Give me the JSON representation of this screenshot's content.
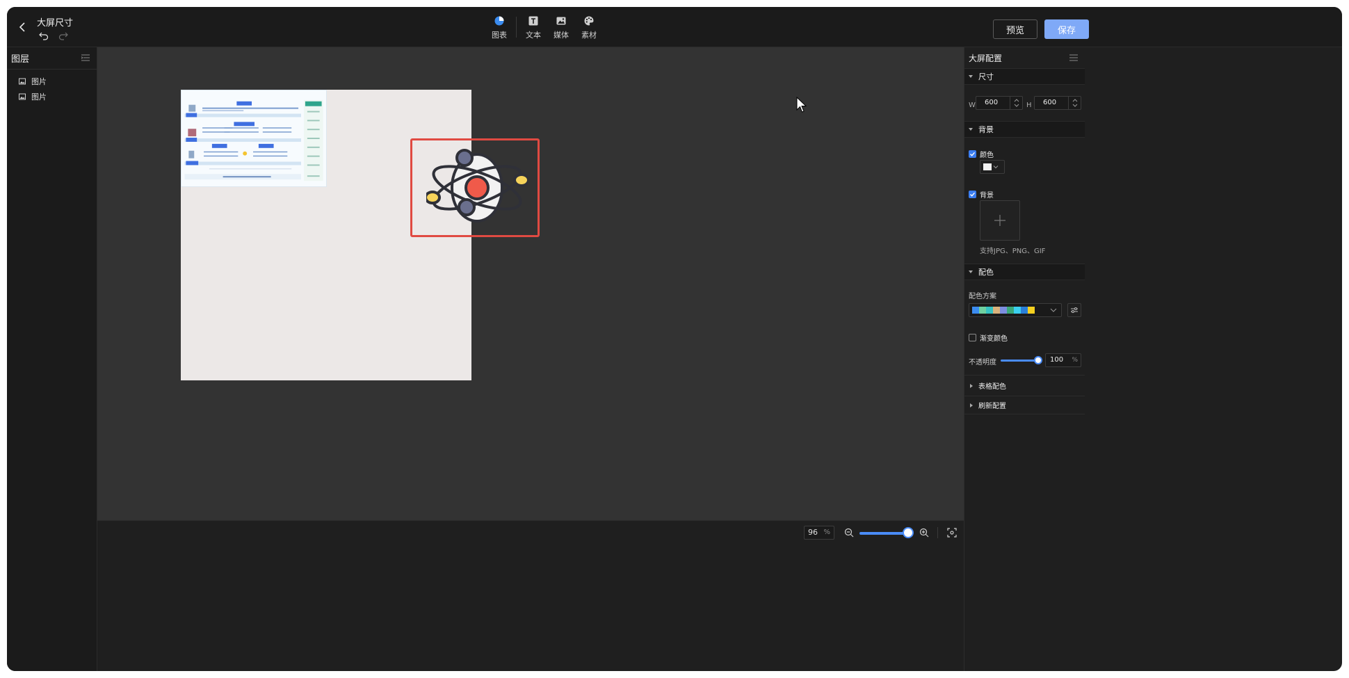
{
  "header": {
    "title": "大屏尺寸",
    "tools": [
      {
        "label": "图表",
        "icon": "chart-pie-icon"
      },
      {
        "label": "文本",
        "icon": "text-icon"
      },
      {
        "label": "媒体",
        "icon": "image-icon"
      },
      {
        "label": "素材",
        "icon": "palette-icon"
      }
    ],
    "preview_label": "预览",
    "save_label": "保存"
  },
  "layers": {
    "title": "图层",
    "items": [
      {
        "label": "图片",
        "icon": "image-icon"
      },
      {
        "label": "图片",
        "icon": "image-icon"
      }
    ]
  },
  "zoom": {
    "value": "96",
    "unit": "%",
    "slider_fraction": 0.96
  },
  "config": {
    "title": "大屏配置",
    "size": {
      "section_label": "尺寸",
      "w_label": "W",
      "w_value": "600",
      "h_label": "H",
      "h_value": "600"
    },
    "background": {
      "section_label": "背景",
      "color_label": "颜色",
      "color_checked": true,
      "color_value": "#f2f2f2",
      "image_label": "背景",
      "image_checked": true,
      "upload_hint": "支持JPG、PNG、GIF"
    },
    "palette": {
      "section_label": "配色",
      "scheme_label": "配色方案",
      "scheme_colors": [
        "#3b8cf0",
        "#6fd0a0",
        "#36c2c2",
        "#d9b27c",
        "#7c8ee0",
        "#3aa87a",
        "#3bd0f0",
        "#2a7fd8",
        "#f5d020"
      ],
      "gradient_label": "渐变颜色",
      "gradient_checked": false,
      "opacity_label": "不透明度",
      "opacity_value": "100",
      "opacity_unit": "%"
    },
    "collapsed_sections": [
      "表格配色",
      "刷新配置"
    ]
  },
  "colors": {
    "accent": "#4a8cf7",
    "save_button": "#7fa9f7",
    "selection_border": "#e04a42"
  }
}
